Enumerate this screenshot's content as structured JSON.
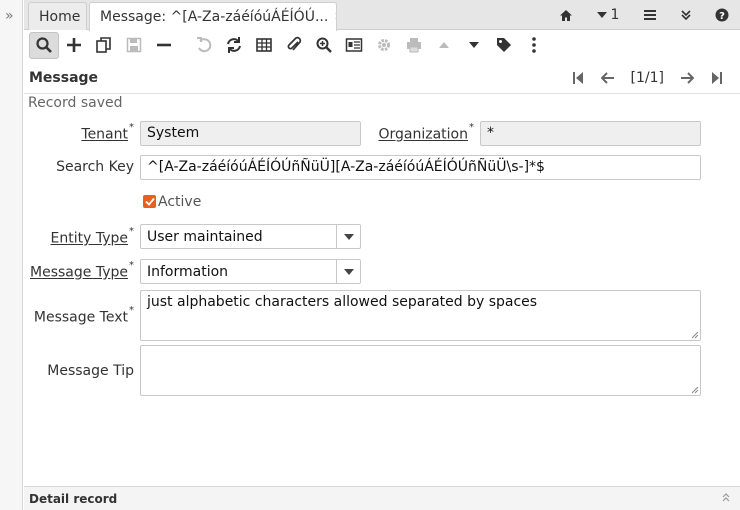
{
  "tabs": {
    "home": "Home",
    "active": "Message: ^[A-Za-záéíóúÁÉÍÓÚ...",
    "close_glyph": "✖"
  },
  "tabbar_right": {
    "history_count": "1"
  },
  "header": {
    "title": "Message",
    "record_counter": "[1/1]"
  },
  "status_text": "Record saved",
  "form": {
    "tenant": {
      "label": "Tenant",
      "value": "System"
    },
    "organization": {
      "label": "Organization",
      "value": "*"
    },
    "search_key": {
      "label": "Search Key",
      "value": "^[A-Za-záéíóúÁÉÍÓÚñÑüÜ][A-Za-záéíóúÁÉÍÓÚñÑüÜ\\s-]*$"
    },
    "active": {
      "label": "Active",
      "checked": true
    },
    "entity_type": {
      "label": "Entity Type",
      "value": "User maintained"
    },
    "message_type": {
      "label": "Message Type",
      "value": "Information"
    },
    "message_text": {
      "label": "Message Text",
      "value": "just alphabetic characters allowed separated by spaces"
    },
    "message_tip": {
      "label": "Message Tip",
      "value": ""
    },
    "required_mark": "*"
  },
  "detail": {
    "title": "Detail record"
  },
  "colors": {
    "accent": "#e85f1e",
    "readonly_bg": "#efefef"
  }
}
